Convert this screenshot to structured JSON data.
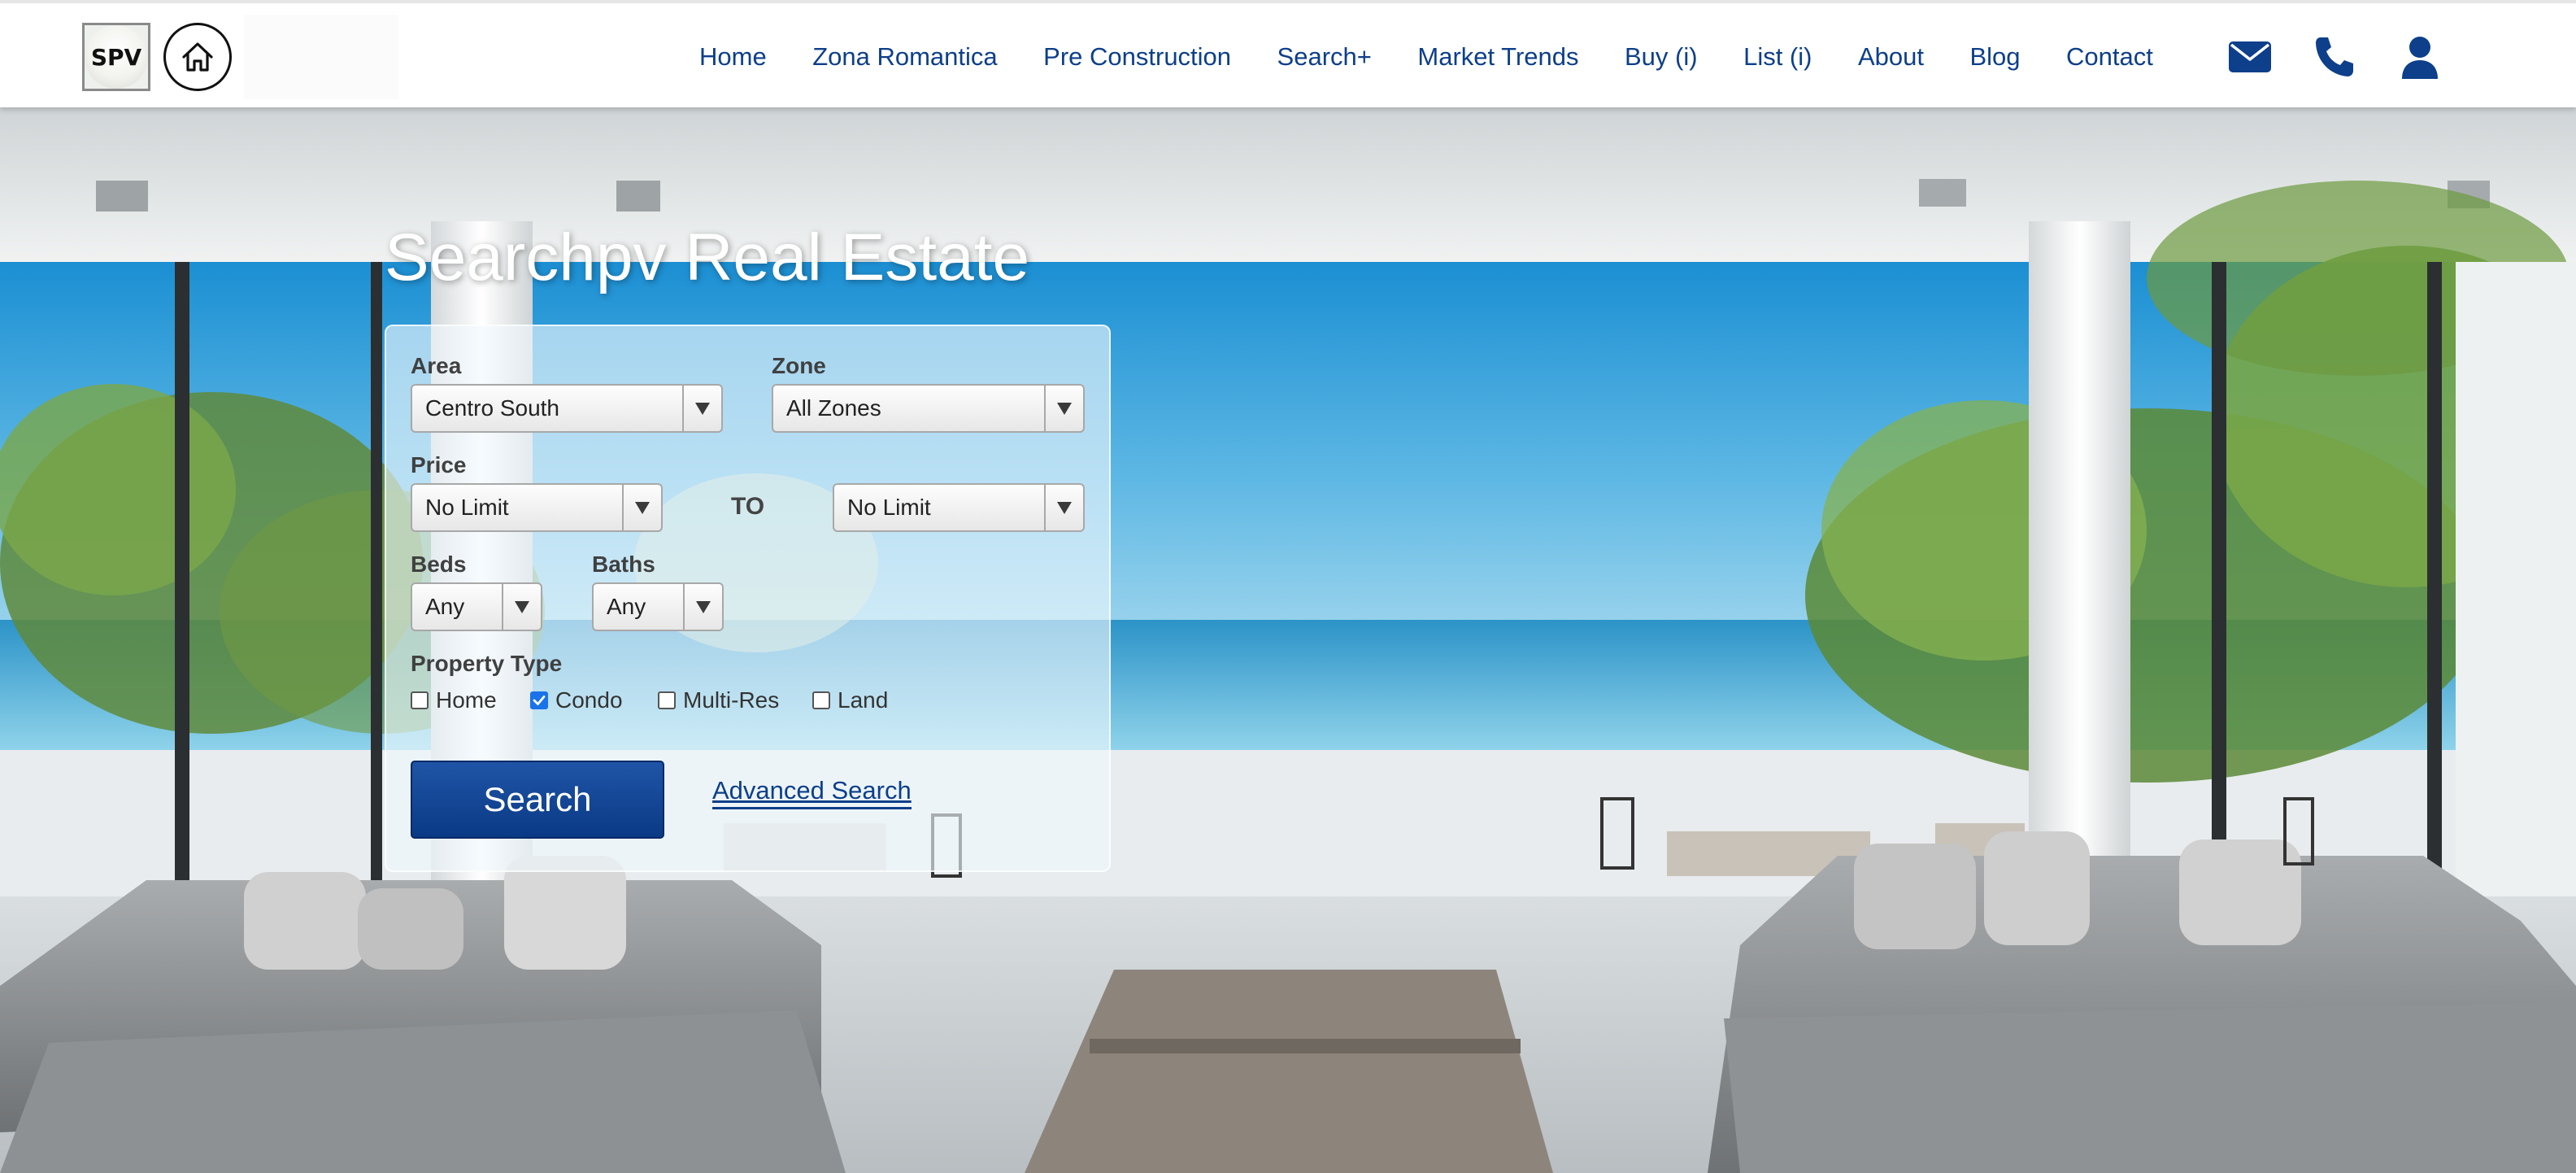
{
  "header": {
    "logo_text": "SPV",
    "nav": [
      "Home",
      "Zona Romantica",
      "Pre Construction",
      "Search+",
      "Market Trends",
      "Buy (i)",
      "List (i)",
      "About",
      "Blog",
      "Contact"
    ],
    "icons": [
      "email-icon",
      "phone-icon",
      "user-icon"
    ],
    "accent_color": "#0d3f8a"
  },
  "hero": {
    "title": "Searchpv Real Estate"
  },
  "search": {
    "area_label": "Area",
    "area_value": "Centro South",
    "zone_label": "Zone",
    "zone_value": "All Zones",
    "price_label": "Price",
    "price_min": "No Limit",
    "price_to": "TO",
    "price_max": "No Limit",
    "beds_label": "Beds",
    "beds_value": "Any",
    "baths_label": "Baths",
    "baths_value": "Any",
    "type_label": "Property Type",
    "types": [
      {
        "label": "Home",
        "checked": false
      },
      {
        "label": "Condo",
        "checked": true
      },
      {
        "label": "Multi-Res",
        "checked": false
      },
      {
        "label": "Land",
        "checked": false
      }
    ],
    "search_button": "Search",
    "advanced_link": "Advanced Search",
    "button_color": "#0a3a86"
  }
}
